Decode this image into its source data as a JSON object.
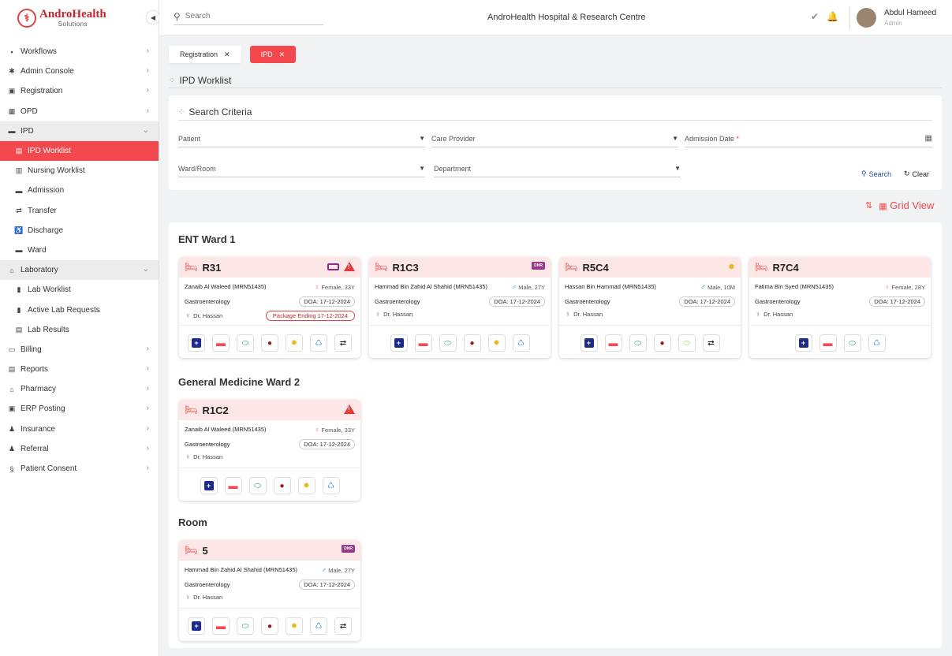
{
  "app": {
    "logo_name": "AndroHealth",
    "logo_sub": "Solutions",
    "hospital": "AndroHealth Hospital & Research Centre"
  },
  "search": {
    "placeholder": "Search"
  },
  "user": {
    "name": "Abdul Hameed",
    "role": "Admin"
  },
  "sidebar": {
    "items": [
      {
        "label": "Workflows",
        "icon": "workflow-icon",
        "chevron": "›"
      },
      {
        "label": "Admin Console",
        "icon": "gear-icon",
        "chevron": "›"
      },
      {
        "label": "Registration",
        "icon": "registration-icon",
        "chevron": "›"
      },
      {
        "label": "OPD",
        "icon": "opd-icon",
        "chevron": "›"
      },
      {
        "label": "IPD",
        "icon": "bed-icon",
        "chevron": "⌄"
      },
      {
        "label": "IPD Worklist",
        "icon": "worklist-icon"
      },
      {
        "label": "Nursing Worklist",
        "icon": "nurse-icon"
      },
      {
        "label": "Admission",
        "icon": "admission-icon"
      },
      {
        "label": "Transfer",
        "icon": "transfer-icon"
      },
      {
        "label": "Discharge",
        "icon": "discharge-icon"
      },
      {
        "label": "Ward",
        "icon": "ward-icon"
      },
      {
        "label": "Laboratory",
        "icon": "lab-icon",
        "chevron": "⌄"
      },
      {
        "label": "Lab Worklist",
        "icon": "test-tube-icon"
      },
      {
        "label": "Active Lab Requests",
        "icon": "test-tube-icon"
      },
      {
        "label": "Lab Results",
        "icon": "document-icon"
      },
      {
        "label": "Billing",
        "icon": "billing-icon",
        "chevron": "›"
      },
      {
        "label": "Reports",
        "icon": "report-icon",
        "chevron": "›"
      },
      {
        "label": "Pharmacy",
        "icon": "pharmacy-icon",
        "chevron": "›"
      },
      {
        "label": "ERP Posting",
        "icon": "erp-icon",
        "chevron": "›"
      },
      {
        "label": "Insurance",
        "icon": "insurance-icon",
        "chevron": "›"
      },
      {
        "label": "Referral",
        "icon": "referral-icon",
        "chevron": "›"
      },
      {
        "label": "Patient Consent",
        "icon": "consent-icon",
        "chevron": "›"
      }
    ]
  },
  "tabs": [
    {
      "label": "Registration"
    },
    {
      "label": "IPD"
    }
  ],
  "page_title": "IPD Worklist",
  "criteria": {
    "title": "Search Criteria",
    "patient": "Patient",
    "care_provider": "Care Provider",
    "admission_date": "Admission Date",
    "required_mark": "*",
    "ward_room": "Ward/Room",
    "department": "Department",
    "search_btn": "Search",
    "clear_btn": "Clear"
  },
  "view": {
    "label": "Grid View"
  },
  "wards": [
    {
      "title": "ENT Ward 1"
    },
    {
      "title": "General Medicine Ward 2"
    },
    {
      "title": "Room"
    }
  ],
  "cards": [
    {
      "room": "R31",
      "patient": "Zanaib Al Waleed (MRN51435)",
      "gender": "Female, 33Y",
      "dept": "Gastroenterology",
      "doa": "DOA: 17-12-2024",
      "doctor": "Dr. Hassan",
      "package": "Package Ending 17-12-2024"
    },
    {
      "room": "R1C3",
      "patient": "Hammad Bin Zahid Al Shahid (MRN51435)",
      "gender": "Male, 27Y",
      "dept": "Gastroenterology",
      "doa": "DOA: 17-12-2024",
      "doctor": "Dr. Hassan",
      "badge": "DNR"
    },
    {
      "room": "R5C4",
      "patient": "Hassan Bin Hammad (MRN51435)",
      "gender": "Male, 10M",
      "dept": "Gastroenterology",
      "doa": "DOA: 17-12-2024",
      "doctor": "Dr. Hassan"
    },
    {
      "room": "R7C4",
      "patient": "Fatima Bin Syed (MRN51435)",
      "gender": "Female, 28Y",
      "dept": "Gastroenterology",
      "doa": "DOA: 17-12-2024",
      "doctor": "Dr. Hassan"
    },
    {
      "room": "R1C2",
      "patient": "Zanaib Al Waleed (MRN51435)",
      "gender": "Female, 33Y",
      "dept": "Gastroenterology",
      "doa": "DOA: 17-12-2024",
      "doctor": "Dr. Hassan"
    },
    {
      "room": "5",
      "patient": "Hammad Bin Zahid Al Shahid (MRN51435)",
      "gender": "Male, 27Y",
      "dept": "Gastroenterology",
      "doa": "DOA: 17-12-2024",
      "doctor": "Dr. Hassan",
      "badge": "DNR"
    }
  ]
}
